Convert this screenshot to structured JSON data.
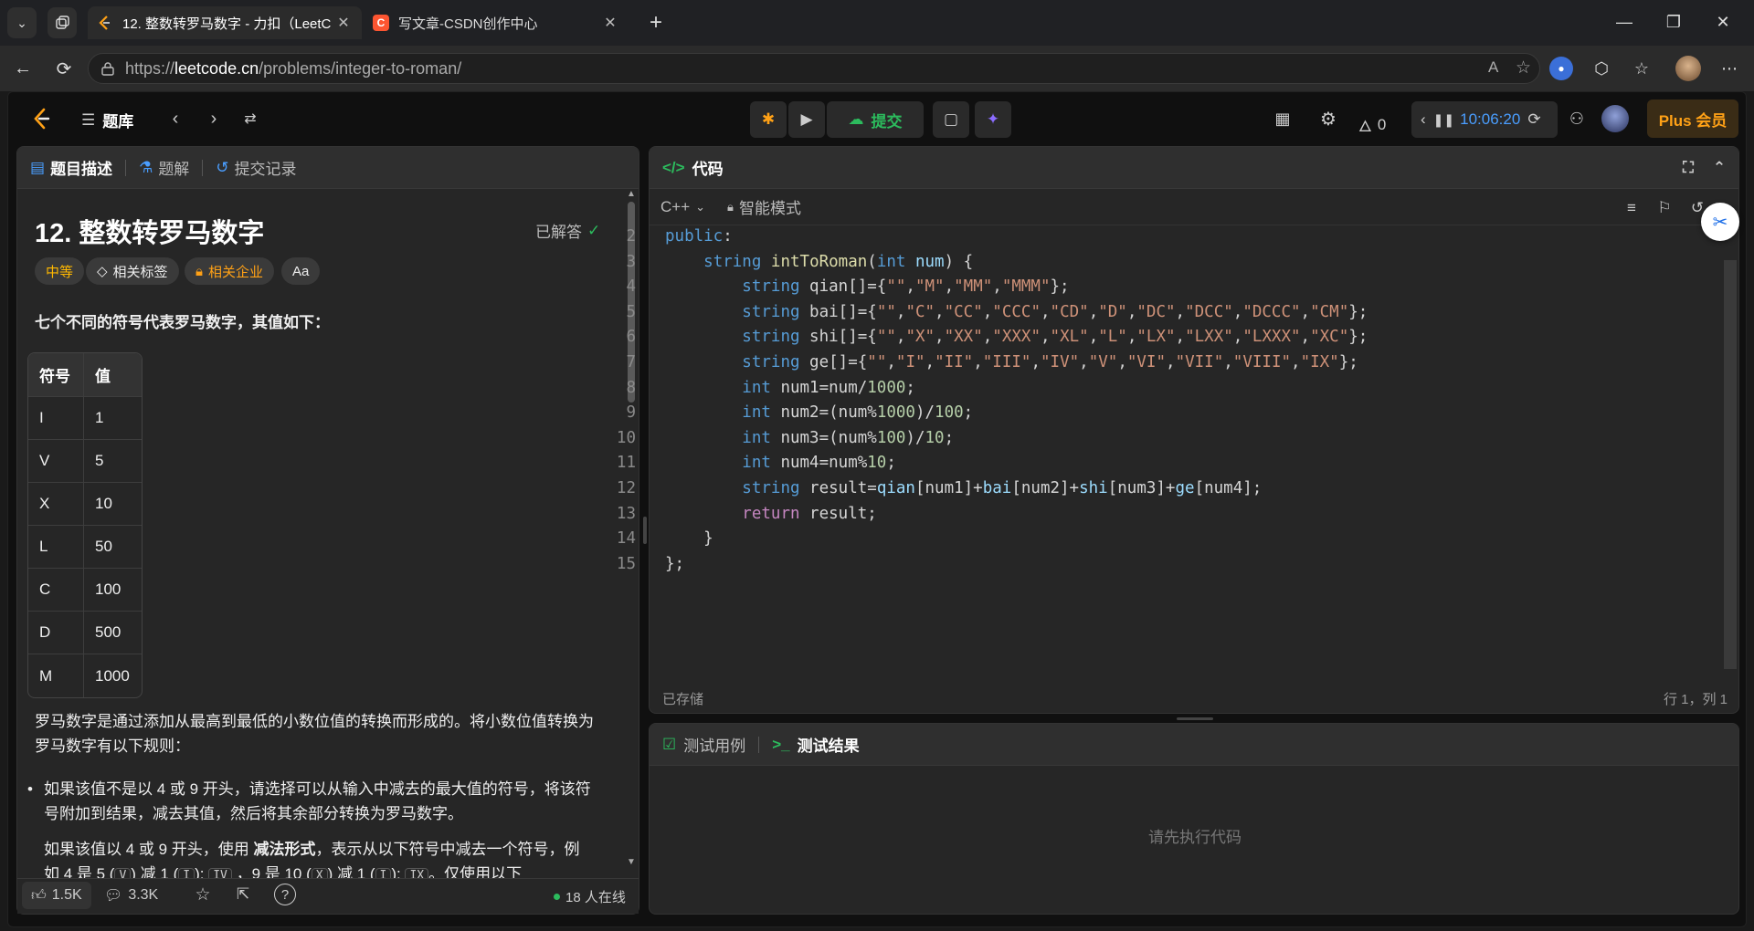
{
  "browser": {
    "tabs": [
      {
        "title": "12. 整数转罗马数字 - 力扣（LeetC",
        "active": true,
        "favicon_color": "#ffa116"
      },
      {
        "title": "写文章-CSDN创作中心",
        "active": false,
        "favicon_color": "#fc5531"
      }
    ],
    "url_prefix": "https://",
    "url_host": "leetcode.cn",
    "url_path": "/problems/integer-to-roman/"
  },
  "topbar": {
    "problem_bank": "题库",
    "submit": "提交",
    "streak": "0",
    "timer": "10:06:20",
    "plus": "Plus 会员"
  },
  "left": {
    "tabs": [
      "题目描述",
      "题解",
      "提交记录"
    ],
    "title": "12. 整数转罗马数字",
    "solved": "已解答",
    "tags": [
      "中等",
      "相关标签",
      "相关企业",
      "Aa"
    ],
    "intro": "七个不同的符号代表罗马数字，其值如下：",
    "table_header": [
      "符号",
      "值"
    ],
    "table_rows": [
      [
        "I",
        "1"
      ],
      [
        "V",
        "5"
      ],
      [
        "X",
        "10"
      ],
      [
        "L",
        "50"
      ],
      [
        "C",
        "100"
      ],
      [
        "D",
        "500"
      ],
      [
        "M",
        "1000"
      ]
    ],
    "para1": "罗马数字是通过添加从最高到最低的小数位值的转换而形成的。将小数位值转换为罗马数字有以下规则：",
    "bullet1": "如果该值不是以 4 或 9 开头，请选择可以从输入中减去的最大值的符号，将该符号附加到结果，减去其值，然后将其余部分转换为罗马数字。",
    "bullet2_a": "如果该值以 4 或 9 开头，使用 ",
    "bullet2_b": "减法形式",
    "bullet2_c": "，表示从以下符号中减去一个符号，例如 4 是 5 (",
    "bullet2_k1": "V",
    "bullet2_d": ") 减 1 (",
    "bullet2_k2": "I",
    "bullet2_e": "): ",
    "bullet2_k3": "IV",
    "bullet2_f": " ，9 是 10 (",
    "bullet2_k4": "X",
    "bullet2_g": ") 减 1 (",
    "bullet2_k5": "I",
    "bullet2_h": "): ",
    "bullet2_k6": "IX",
    "bullet2_i": "。仅使用以下",
    "footer": {
      "likes": "1.5K",
      "comments": "3.3K",
      "online": "18 人在线"
    }
  },
  "editor": {
    "header": "代码",
    "language": "C++",
    "mode": "智能模式",
    "status_saved": "已存储",
    "cursor": "行 1，列 1"
  },
  "code_lines": [
    {
      "n": "2",
      "t": "public:"
    },
    {
      "n": "3",
      "t": "    string intToRoman(int num) {"
    },
    {
      "n": "4",
      "t": "        string qian[]={\"\",\"M\",\"MM\",\"MMM\"};"
    },
    {
      "n": "5",
      "t": "        string bai[]={\"\",\"C\",\"CC\",\"CCC\",\"CD\",\"D\",\"DC\",\"DCC\",\"DCCC\",\"CM\"};"
    },
    {
      "n": "6",
      "t": "        string shi[]={\"\",\"X\",\"XX\",\"XXX\",\"XL\",\"L\",\"LX\",\"LXX\",\"LXXX\",\"XC\"};"
    },
    {
      "n": "7",
      "t": "        string ge[]={\"\",\"I\",\"II\",\"III\",\"IV\",\"V\",\"VI\",\"VII\",\"VIII\",\"IX\"};"
    },
    {
      "n": "8",
      "t": "        int num1=num/1000;"
    },
    {
      "n": "9",
      "t": "        int num2=(num%1000)/100;"
    },
    {
      "n": "10",
      "t": "        int num3=(num%100)/10;"
    },
    {
      "n": "11",
      "t": "        int num4=num%10;"
    },
    {
      "n": "12",
      "t": "        string result=qian[num1]+bai[num2]+shi[num3]+ge[num4];"
    },
    {
      "n": "13",
      "t": "        return result;"
    },
    {
      "n": "14",
      "t": "    }"
    },
    {
      "n": "15",
      "t": "};"
    }
  ],
  "testpanel": {
    "tabs": [
      "测试用例",
      "测试结果"
    ],
    "placeholder": "请先执行代码"
  },
  "colors": {
    "accent_green": "#2cbb5d",
    "accent_orange": "#ffa116",
    "timer_blue": "#4a9eff"
  }
}
